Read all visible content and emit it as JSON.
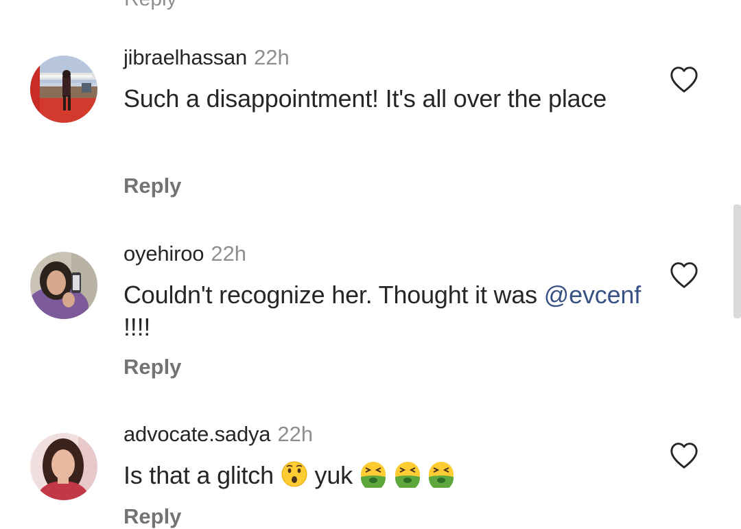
{
  "partial_top": {
    "label": "Reply"
  },
  "comments": [
    {
      "username": "jibraelhassan",
      "time": "22h",
      "text": "Such a disappointment! It's all over the place",
      "reply_label": "Reply",
      "avatar": "stage-performer-photo"
    },
    {
      "username": "oyehiroo",
      "time": "22h",
      "text_before": "Couldn't recognize her. Thought it was",
      "mention": "@evcenf",
      "text_after": " !!!!",
      "reply_label": "Reply",
      "avatar": "woman-selfie-photo"
    },
    {
      "username": "advocate.sadya",
      "time": "22h",
      "text_before": "Is that a glitch",
      "text_after": "yuk",
      "emojis": [
        "hushed-face-emoji",
        "nauseated-face-emoji",
        "nauseated-face-emoji",
        "nauseated-face-emoji"
      ],
      "reply_label": "Reply",
      "avatar": "woman-portrait-photo"
    }
  ],
  "icons": {
    "like": "heart-outline-icon"
  },
  "colors": {
    "text": "#262626",
    "muted": "#8e8e8e",
    "mention": "#385185",
    "scrollbar": "#dadada"
  }
}
